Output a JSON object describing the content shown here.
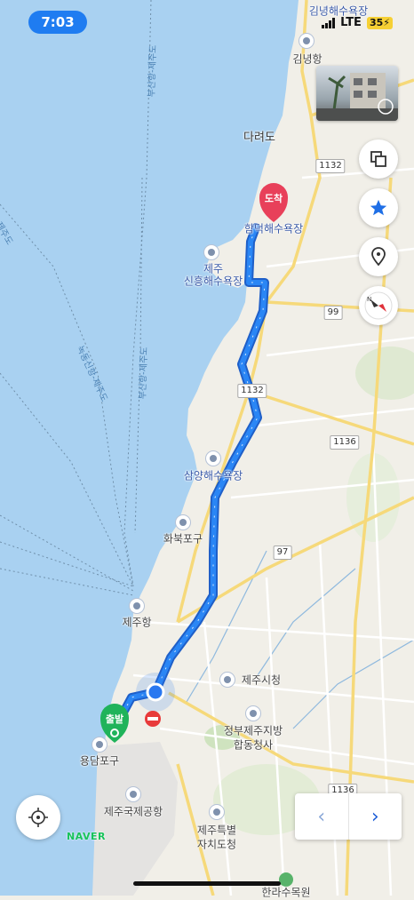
{
  "status_bar": {
    "time": "7:03",
    "network": "LTE",
    "battery": "35"
  },
  "map": {
    "destination_tag": "도착",
    "origin_tag": "출발",
    "sea_labels": [
      "부산항-제주도",
      "부산항-제주도",
      "녹동신항-제주도",
      "제주도"
    ],
    "place_labels": {
      "gimnyeong_beach": "김녕해수욕장",
      "gimnyeong_port": "김녕항",
      "darado": "다려도",
      "hamdeok_beach": "함덕해수욕장",
      "sinheung_line1": "제주",
      "sinheung_line2": "신흥해수욕장",
      "samyang_beach": "삼양해수욕장",
      "hwabuk_port": "화북포구",
      "jeju_port": "제주항",
      "jeju_city_hall": "제주시청",
      "gov_complex_line1": "정부제주지방",
      "gov_complex_line2": "합동청사",
      "yongdam_port": "용담포구",
      "jeju_airport": "제주국제공항",
      "jeju_province_line1": "제주특별",
      "jeju_province_line2": "자치도청",
      "hanla_arboretum": "한라수목원"
    },
    "road_numbers": {
      "r1": "1132",
      "r2": "99",
      "r3": "1132",
      "r4": "1136",
      "r5": "97",
      "r6": "1136"
    }
  },
  "controls": {
    "naver_logo": "NAVER",
    "prev": "‹",
    "next": "›"
  },
  "colors": {
    "route": "#2a78f0",
    "destination": "#e8405a",
    "origin": "#20b35a",
    "sea": "#a9d1f1",
    "land": "#f1efe8"
  }
}
